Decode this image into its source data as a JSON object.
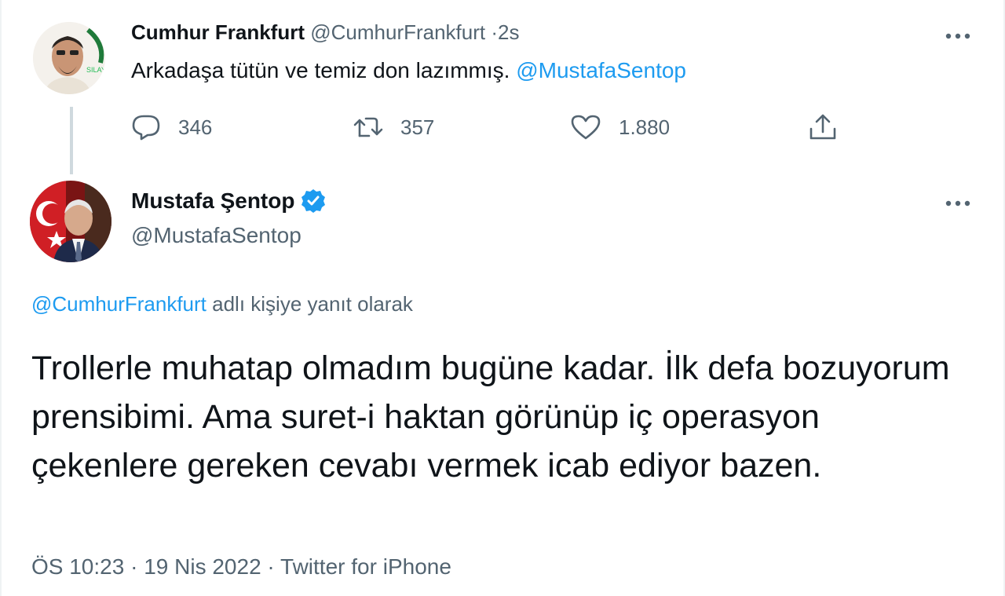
{
  "reply_tweet": {
    "author_name": "Cumhur Frankfurt",
    "author_handle": "@CumhurFrankfurt",
    "separator": "·",
    "time": "2s",
    "text": "Arkadaşa tütün ve temiz don lazımmış.",
    "mention": "@MustafaSentop",
    "avatar_badge_text": "SILAY",
    "actions": {
      "replies": "346",
      "retweets": "357",
      "likes": "1.880"
    },
    "icons": {
      "reply": "reply-icon",
      "retweet": "retweet-icon",
      "like": "heart-icon",
      "share": "share-icon",
      "more": "more-icon"
    }
  },
  "main_tweet": {
    "author_name": "Mustafa Şentop",
    "author_handle": "@MustafaSentop",
    "verified": true,
    "replying_to_handle": "@CumhurFrankfurt",
    "replying_to_suffix": "adlı kişiye yanıt olarak",
    "text": "Trollerle muhatap olmadım bugüne kadar. İlk defa bozuyorum prensibimi. Ama suret-i haktan görünüp iç operasyon çekenlere gereken cevabı vermek icab ediyor bazen.",
    "time": "ÖS 10:23",
    "date": "19 Nis 2022",
    "source": "Twitter for iPhone",
    "separator": "·"
  },
  "colors": {
    "link": "#1d9bf0",
    "text": "#0f1419",
    "muted": "#536471",
    "thread_line": "#cfd9de",
    "verified": "#1d9bf0"
  }
}
